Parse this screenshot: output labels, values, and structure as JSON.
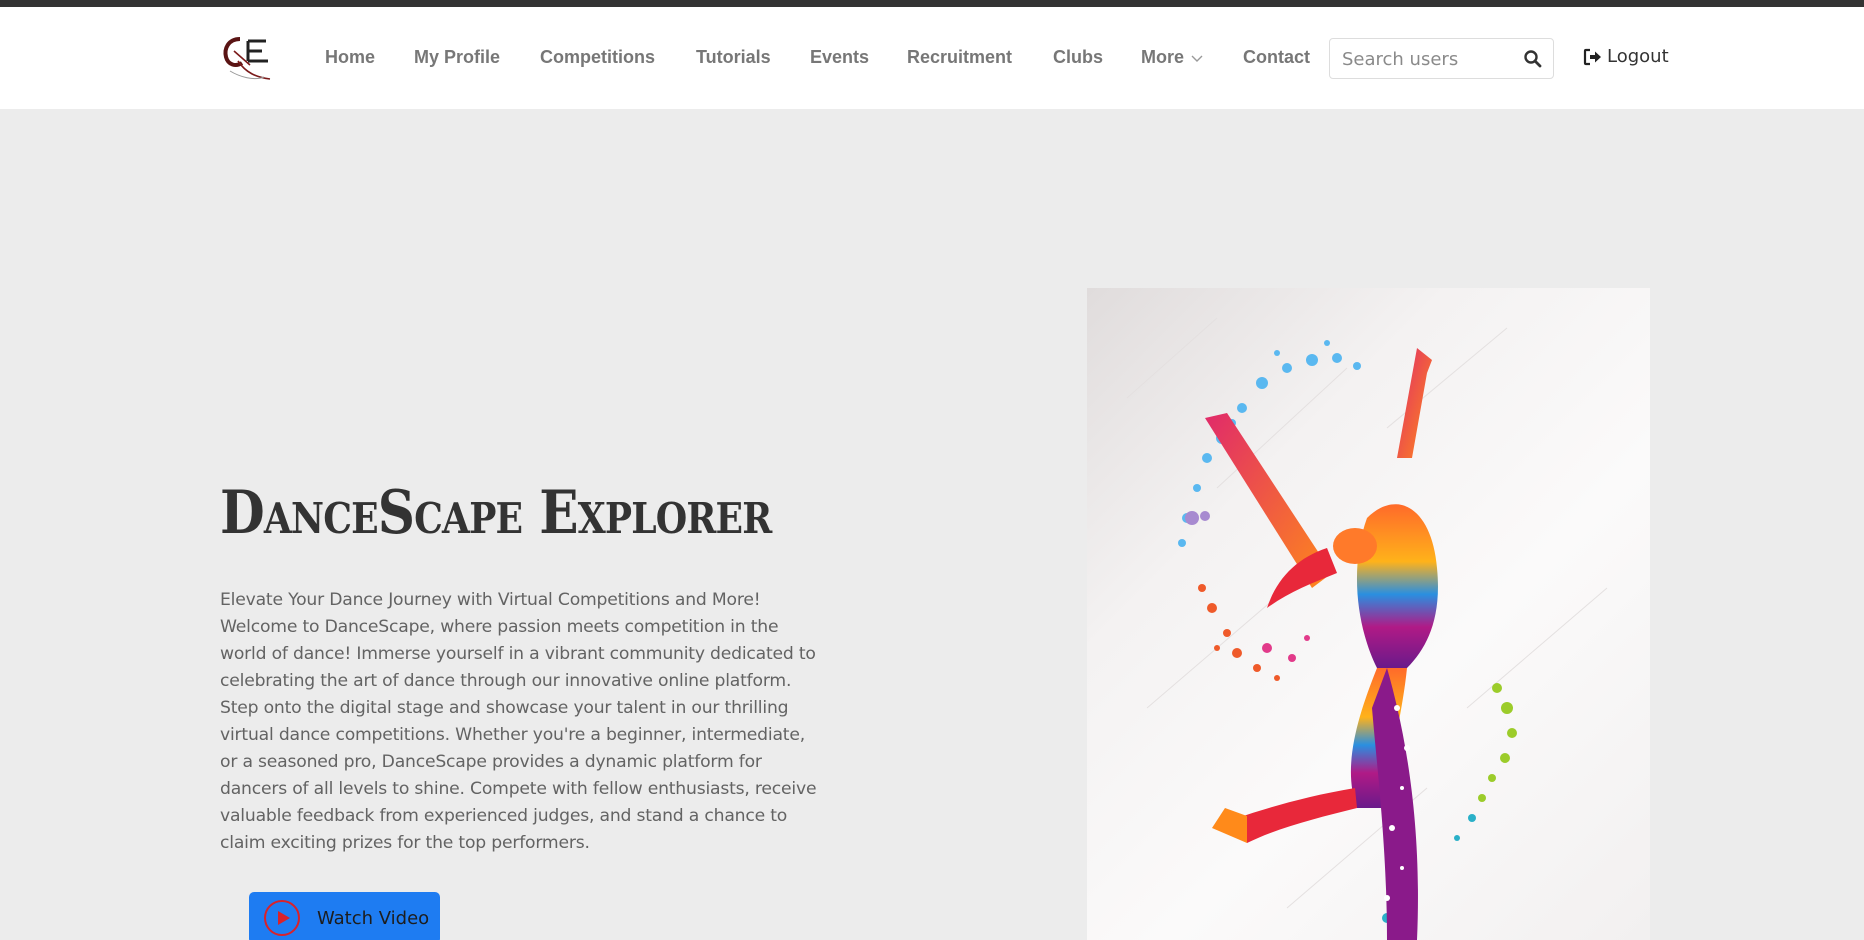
{
  "nav": {
    "logo_text": "QE",
    "links": [
      "Home",
      "My Profile",
      "Competitions",
      "Tutorials",
      "Events",
      "Recruitment",
      "Clubs"
    ],
    "more_label": "More",
    "contact_label": "Contact",
    "search_placeholder": "Search users",
    "logout_label": "Logout"
  },
  "hero": {
    "title": "DanceScape Explorer",
    "description": "Elevate Your Dance Journey with Virtual Competitions and More! Welcome to DanceScape, where passion meets competition in the world of dance! Immerse yourself in a vibrant community dedicated to celebrating the art of dance through our innovative online platform. Step onto the digital stage and showcase your talent in our thrilling virtual dance competitions. Whether you're a beginner, intermediate, or a seasoned pro, DanceScape provides a dynamic platform for dancers of all levels to shine. Compete with fellow enthusiasts, receive valuable feedback from experienced judges, and stand a chance to claim exciting prizes for the top performers.",
    "button_label": "Watch Video"
  },
  "colors": {
    "topbar": "#333333",
    "nav_link": "#777777",
    "button_bg": "#1e7cf2",
    "play_icon": "#d9222a",
    "page_bg": "#ececec"
  },
  "icons": [
    "logo",
    "chevron-down-icon",
    "search-icon",
    "logout-icon",
    "play-icon",
    "dancer-illustration"
  ]
}
